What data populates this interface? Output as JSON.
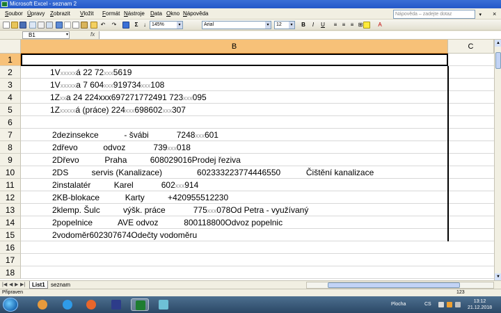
{
  "window": {
    "title": "Microsoft Excel - seznam 2"
  },
  "menu": {
    "items": [
      "Soubor",
      "Úpravy",
      "Zobrazit",
      "Vložit",
      "Formát",
      "Nástroje",
      "Data",
      "Okno",
      "Nápověda"
    ]
  },
  "help_box": {
    "placeholder": "Nápověda – zadejte dotaz"
  },
  "toolbar": {
    "zoom": "145%",
    "font_name": "Arial",
    "font_size": "12",
    "bold_label": "B",
    "italic_label": "I",
    "underline_label": "U",
    "sigma": "Σ"
  },
  "formula_bar": {
    "name_box": "B1",
    "fx_label": "fx",
    "content": ""
  },
  "columns": [
    "B",
    "C"
  ],
  "rows": [
    {
      "num": "1",
      "cell": []
    },
    {
      "num": "2",
      "cell": [
        [
          "1V",
          "n"
        ],
        [
          "xxxxx",
          "f"
        ],
        [
          "á 22 72",
          "n"
        ],
        [
          "xxx",
          "f"
        ],
        [
          "5619",
          "n"
        ]
      ]
    },
    {
      "num": "3",
      "cell": [
        [
          "1V",
          "n"
        ],
        [
          "xxxxx",
          "f"
        ],
        [
          "a 7 604",
          "n"
        ],
        [
          "xxx",
          "f"
        ],
        [
          "919734",
          "n"
        ],
        [
          "xxx",
          "f"
        ],
        [
          "108",
          "n"
        ]
      ]
    },
    {
      "num": "4",
      "cell": [
        [
          "1Z",
          "n"
        ],
        [
          "xx",
          "f"
        ],
        [
          "a 24 224xxx697271772491 723",
          "n"
        ],
        [
          "xxx",
          "f"
        ],
        [
          "095",
          "n"
        ]
      ]
    },
    {
      "num": "5",
      "cell": [
        [
          "1Z",
          "n"
        ],
        [
          "xxxxx",
          "f"
        ],
        [
          "á (práce) 224",
          "n"
        ],
        [
          "xxx",
          "f"
        ],
        [
          "698602",
          "n"
        ],
        [
          "xxx",
          "f"
        ],
        [
          "307",
          "n"
        ]
      ]
    },
    {
      "num": "6",
      "cell": []
    },
    {
      "num": "7",
      "cell": [
        [
          "2dezinsekce           - švábi            7248",
          "n"
        ],
        [
          "xxx",
          "f"
        ],
        [
          "601",
          "n"
        ]
      ]
    },
    {
      "num": "8",
      "cell": [
        [
          "2dřevo           odvoz            739",
          "n"
        ],
        [
          "xxx",
          "f"
        ],
        [
          "018",
          "n"
        ]
      ]
    },
    {
      "num": "9",
      "cell": [
        [
          "2Dřevo           Praha          608029016Prodej řeziva",
          "n"
        ]
      ]
    },
    {
      "num": "10",
      "cell": [
        [
          "2DS          servis (Kanalizace)               602333223774446550           Čištění kanalizace",
          "n"
        ]
      ]
    },
    {
      "num": "11",
      "cell": [
        [
          "2instalatér          Karel            602",
          "n"
        ],
        [
          "xxx",
          "f"
        ],
        [
          "914",
          "n"
        ]
      ]
    },
    {
      "num": "12",
      "cell": [
        [
          "2KB-blokace           Karty          +420955512230",
          "n"
        ]
      ]
    },
    {
      "num": "13",
      "cell": [
        [
          "2klemp. Šulc          výšk. práce            775",
          "n"
        ],
        [
          "xxx",
          "f"
        ],
        [
          "078Od Petra - využívaný",
          "n"
        ]
      ]
    },
    {
      "num": "14",
      "cell": [
        [
          "2popelnice           AVE odvoz           800118800Odvoz popelnic",
          "n"
        ]
      ]
    },
    {
      "num": "15",
      "cell": [
        [
          "2vodoměr602307674Odečty vodoměru",
          "n"
        ]
      ]
    },
    {
      "num": "16",
      "cell": []
    },
    {
      "num": "17",
      "cell": []
    },
    {
      "num": "18",
      "cell": []
    }
  ],
  "sheets": [
    "List1",
    "seznam"
  ],
  "status": {
    "left": "Připraven",
    "right": "123"
  },
  "taskbar": {
    "plocha": "Plocha",
    "lang": "CS",
    "time": "13:12",
    "date": "21.12.2018"
  },
  "colors": {
    "active_header": "#f7c178",
    "title_bar": "#2458c8",
    "faded_text": "#9a9a9a"
  }
}
